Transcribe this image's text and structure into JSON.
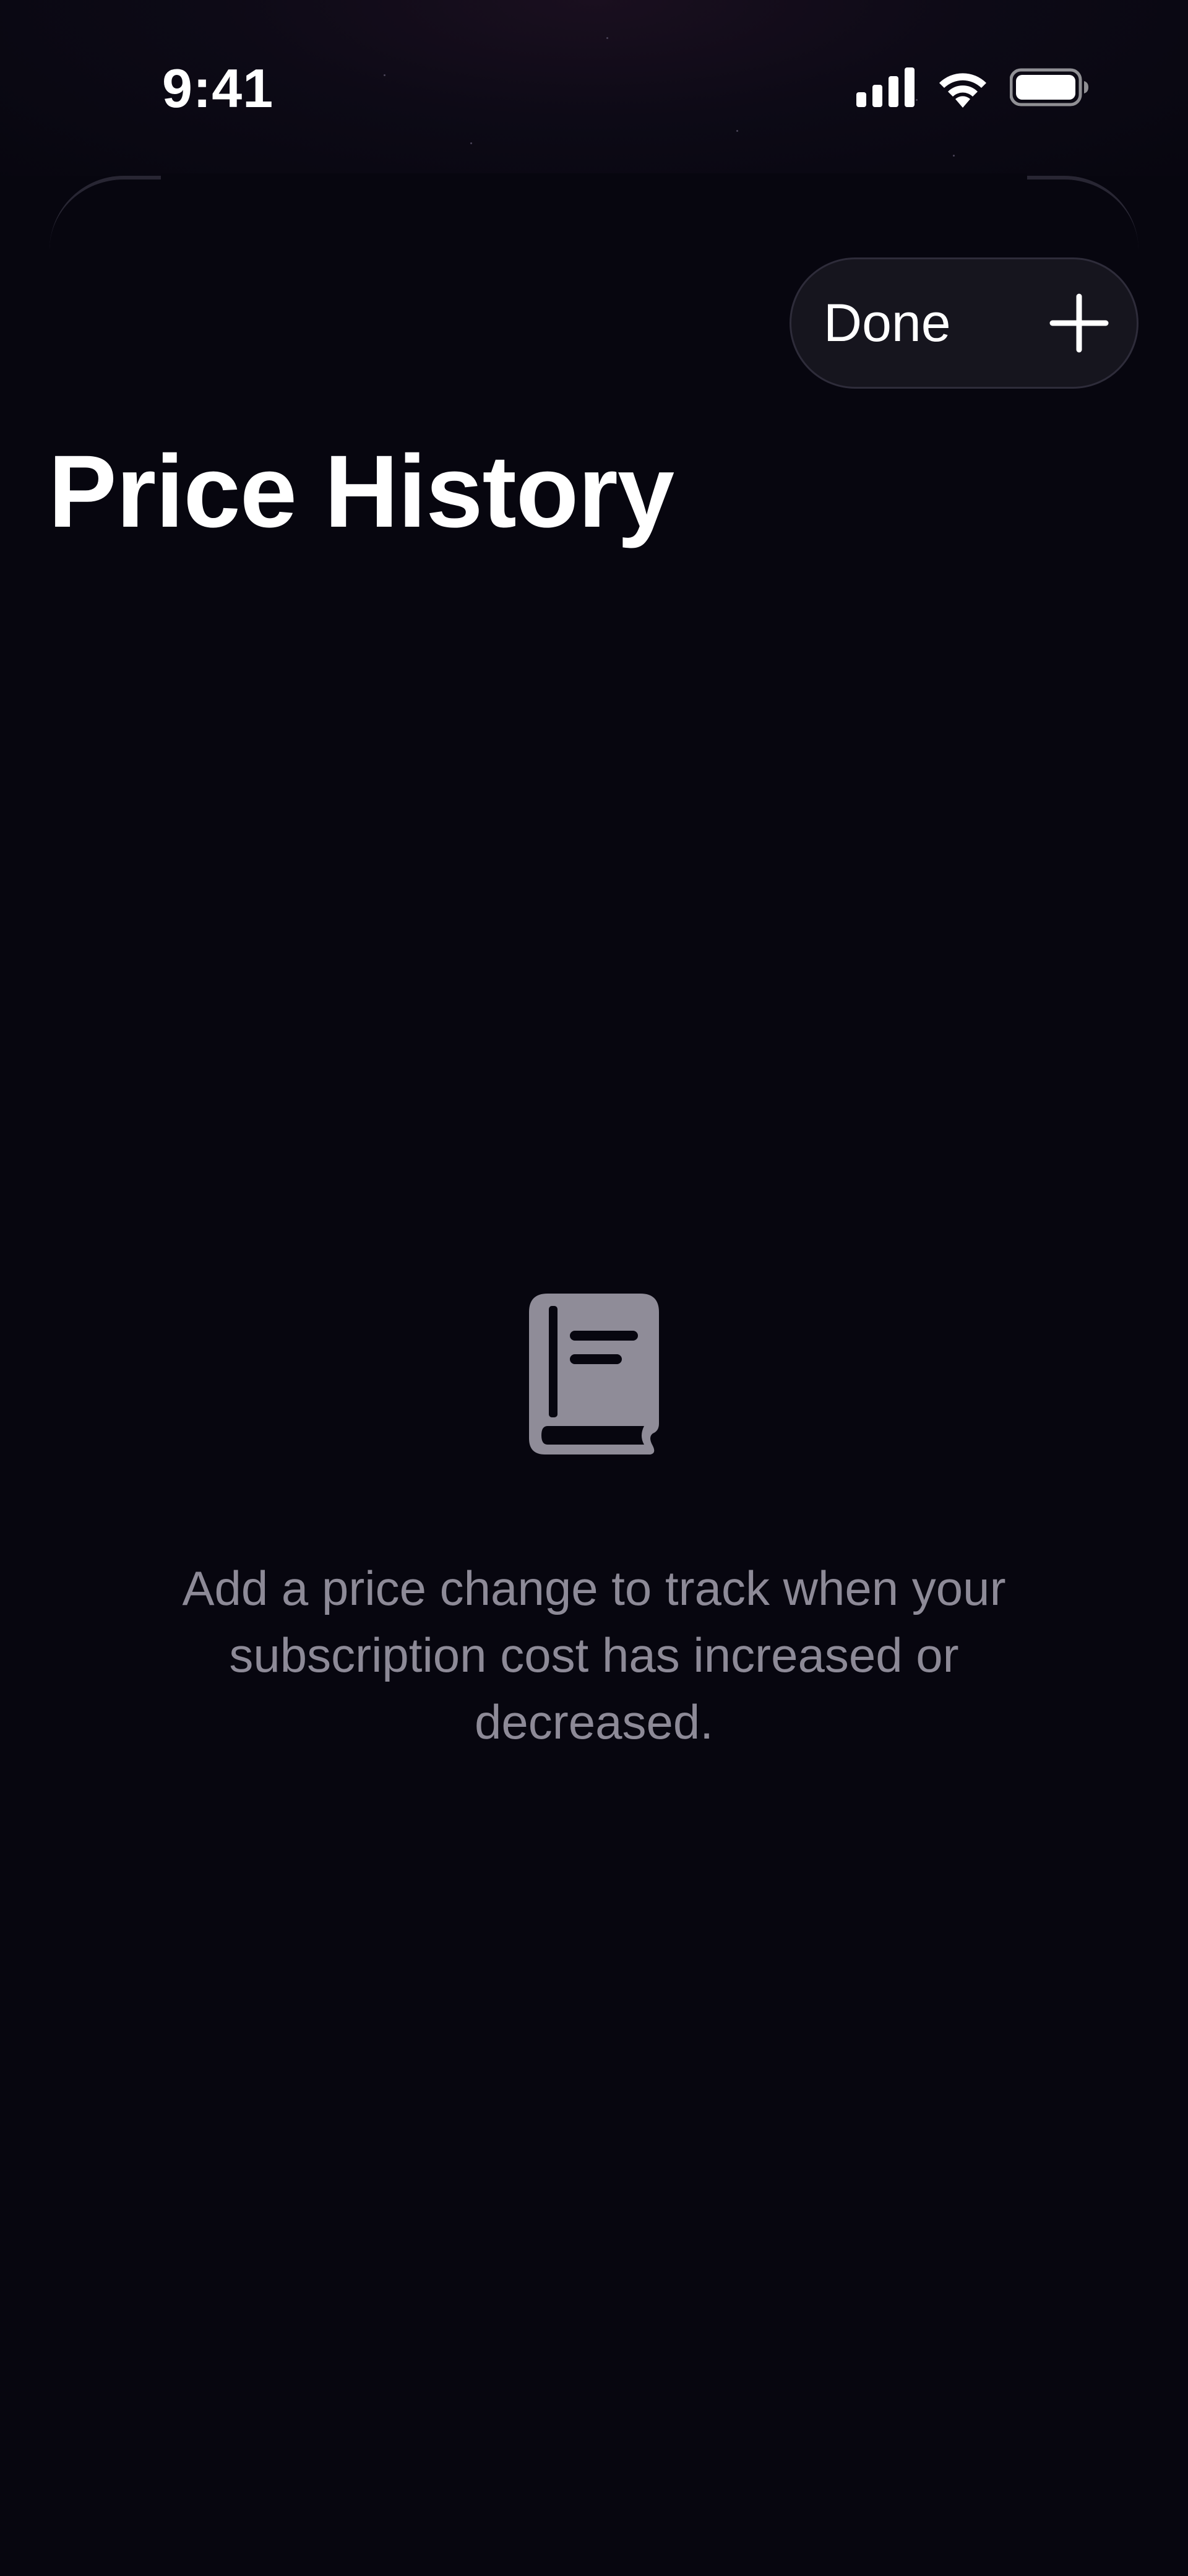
{
  "status_bar": {
    "time": "9:41",
    "icons": [
      "cellular-signal-icon",
      "wifi-icon",
      "battery-icon"
    ]
  },
  "toolbar": {
    "done_label": "Done",
    "add_icon": "plus-icon"
  },
  "header": {
    "title": "Price History"
  },
  "empty_state": {
    "icon": "book-icon",
    "message": "Add a price change to track when your subscription cost has increased or decreased."
  },
  "colors": {
    "background": "#07060f",
    "pill_background": "#16151e",
    "text_primary": "#ffffff",
    "text_secondary": "#8d8a97",
    "icon_muted": "#8f8c98"
  }
}
